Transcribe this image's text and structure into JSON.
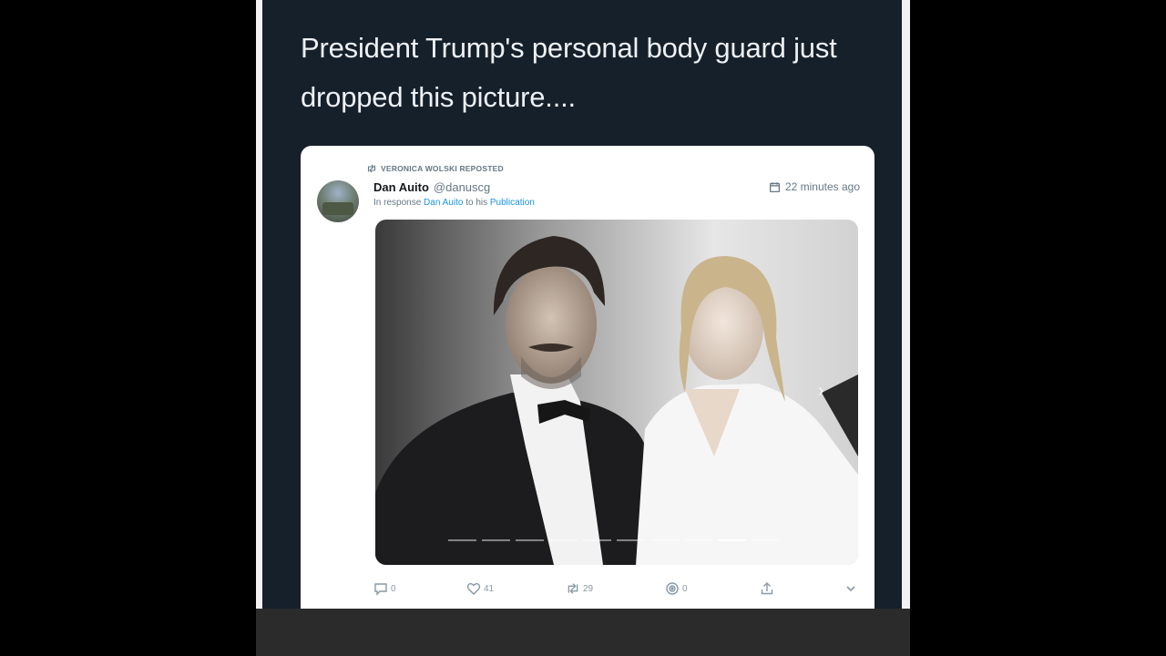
{
  "headline": "President Trump's personal body guard just dropped this picture....",
  "tweet": {
    "repost_label": "VERONICA WOLSKI REPOSTED",
    "author_name": "Dan Auito",
    "author_handle": "@danuscg",
    "in_response_prefix": "In response",
    "in_response_name": "Dan Auito",
    "in_response_mid": "to his",
    "in_response_target": "Publication",
    "timestamp": "22 minutes ago",
    "carousel": {
      "slides": 10,
      "active_index": 8
    },
    "actions": {
      "reply_count": "0",
      "like_count": "41",
      "retweet_count": "29",
      "other_count": "0"
    }
  },
  "icons": [
    "retweet-icon",
    "calendar-icon",
    "reply-icon",
    "heart-icon",
    "retweet-icon",
    "eye-icon",
    "share-icon",
    "chevron-down-icon"
  ],
  "colors": {
    "panel_background": "#15202b",
    "card_background": "#ffffff",
    "link": "#1b95e0",
    "muted": "#657786"
  }
}
